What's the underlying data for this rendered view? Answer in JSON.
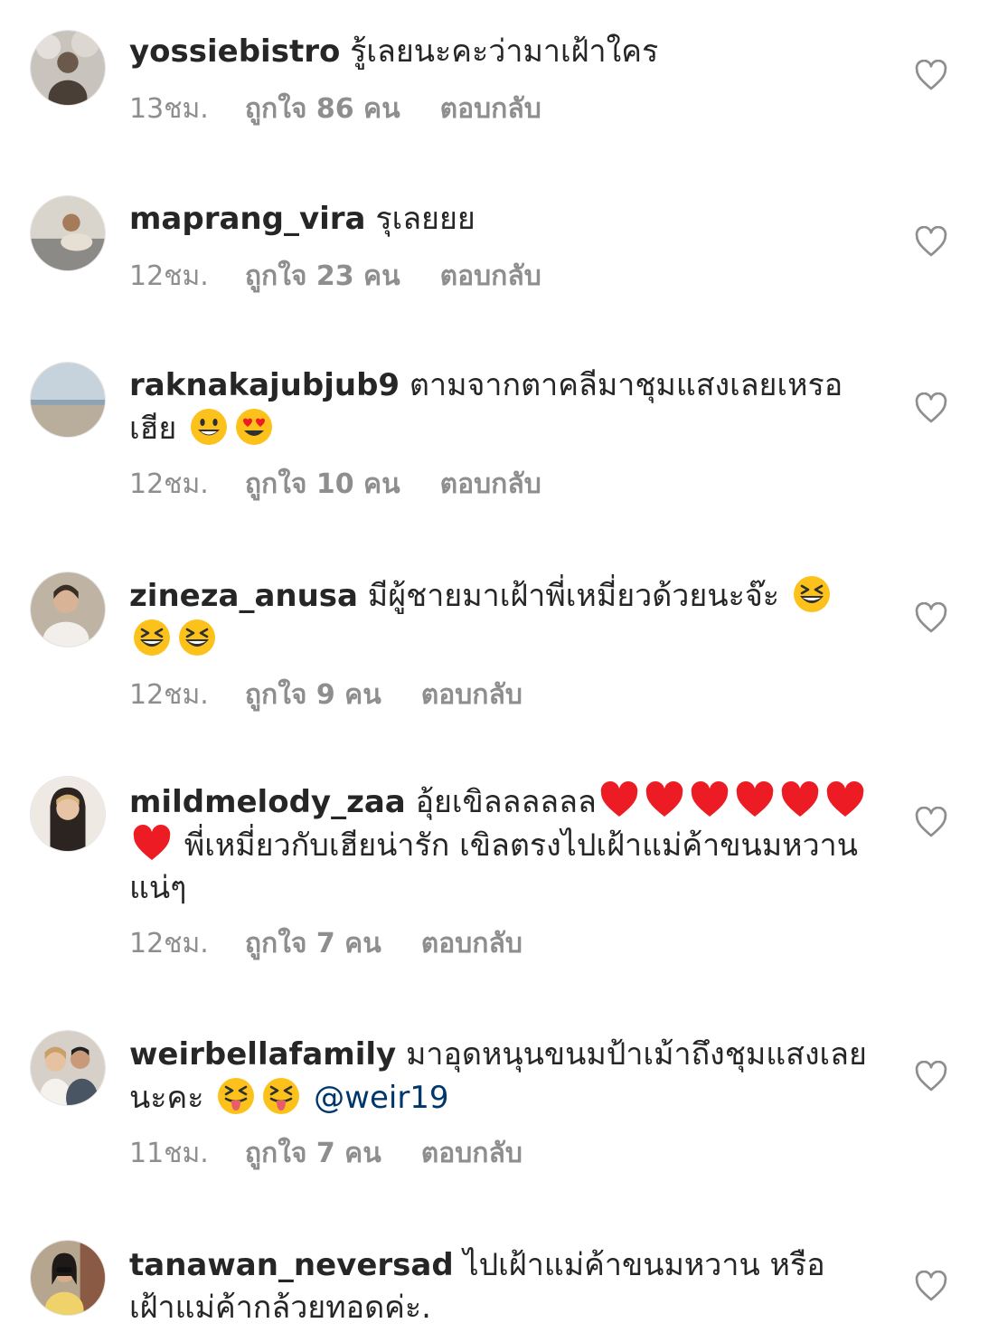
{
  "comments": [
    {
      "username": "yossiebistro",
      "text": "รู้เลยนะคะว่ามาเฝ้าใคร",
      "time": "13ชม.",
      "likes": "ถูกใจ 86 คน",
      "reply": "ตอบกลับ"
    },
    {
      "username": "maprang_vira",
      "text": "รุเลยยย",
      "time": "12ชม.",
      "likes": "ถูกใจ 23 คน",
      "reply": "ตอบกลับ"
    },
    {
      "username": "raknakajubjub9",
      "text": "ตามจากตาคลีมาชุมแสงเลยเหรอเฮีย",
      "time": "12ชม.",
      "likes": "ถูกใจ 10 คน",
      "reply": "ตอบกลับ"
    },
    {
      "username": "zineza_anusa",
      "text": "มีผู้ชายมาเฝ้าพี่เหมี่ยวด้วยนะจ๊ะ",
      "time": "12ชม.",
      "likes": "ถูกใจ 9 คน",
      "reply": "ตอบกลับ"
    },
    {
      "username": "mildmelody_zaa",
      "text": "อุ้ยเขิลลลลลล",
      "text2": "พี่เหมี่ยวกับเฮียน่ารัก เขิลตรงไปเฝ้าแม่ค้าขนมหวานแน่ๆ",
      "time": "12ชม.",
      "likes": "ถูกใจ 7 คน",
      "reply": "ตอบกลับ"
    },
    {
      "username": "weirbellafamily",
      "text": "มาอุดหนุนขนมป้าเม้าถึงชุมแสงเลยนะคะ",
      "mention": "@weir19",
      "time": "11ชม.",
      "likes": "ถูกใจ 7 คน",
      "reply": "ตอบกลับ"
    },
    {
      "username": "tanawan_neversad",
      "text": "ไปเฝ้าแม่ค้าขนมหวาน หรือเฝ้าแม่ค้ากล้วยทอดค่ะ."
    }
  ],
  "colors": {
    "text": "#262626",
    "meta": "#8e8e8e",
    "mention": "#00376b",
    "heart_outline": "#8e8e8e",
    "emoji_heart": "#ed1c24",
    "emoji_face": "#fcc21b"
  },
  "icons": {
    "like": "heart-outline-icon",
    "emoji_smile": "smiling-face-emoji",
    "emoji_heart_eyes": "heart-eyes-emoji",
    "emoji_laugh": "grinning-squinting-face-emoji",
    "emoji_red_heart": "red-heart-emoji",
    "emoji_tongue": "squinting-tongue-face-emoji"
  }
}
